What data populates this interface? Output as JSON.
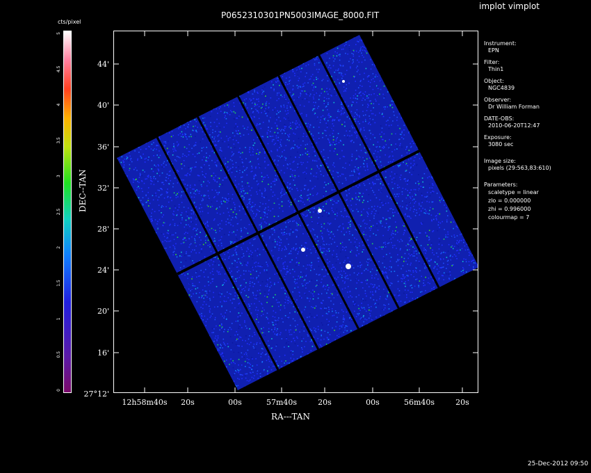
{
  "app": {
    "title": "implot vimplot"
  },
  "plot": {
    "title": "P0652310301PN5003IMAGE_8000.FIT",
    "xlabel": "RA---TAN",
    "ylabel": "DEC--TAN",
    "yticks": [
      "44'",
      "40'",
      "36'",
      "32'",
      "28'",
      "24'",
      "20'",
      "16'",
      "27°12'"
    ],
    "xticks": [
      "12h58m40s",
      "20s",
      "00s",
      "57m40s",
      "20s",
      "00s",
      "56m40s",
      "20s"
    ]
  },
  "colorbar": {
    "label": "cts/pixel",
    "ticks": [
      "5",
      "4.5",
      "4",
      "3.5",
      "3",
      "2.5",
      "2",
      "1.5",
      "1",
      "0.5",
      "0"
    ]
  },
  "info": {
    "instrument_label": "Instrument:",
    "instrument_value": "EPN",
    "filter_label": "Filter:",
    "filter_value": "Thin1",
    "object_label": "Object:",
    "object_value": "NGC4839",
    "observer_label": "Observer:",
    "observer_value": "Dr William Forman",
    "date_label": "DATE-OBS:",
    "date_value": "2010-06-20T12:47",
    "exposure_label": "Exposure:",
    "exposure_value": "3080 sec",
    "size_label": "Image size:",
    "size_value": "pixels (29:563,83:610)",
    "params_label": "Parameters:",
    "scaletype": "scaletype = linear",
    "zlo": "zlo = 0.000000",
    "zhi": "zhi = 0.996000",
    "colourmap": "colourmap = 7"
  },
  "footer": {
    "datestamp": "25-Dec-2012 09:50"
  },
  "colors": {
    "background": "#000000",
    "foreground": "#ffffff",
    "image_base": "#1a2bd8"
  }
}
